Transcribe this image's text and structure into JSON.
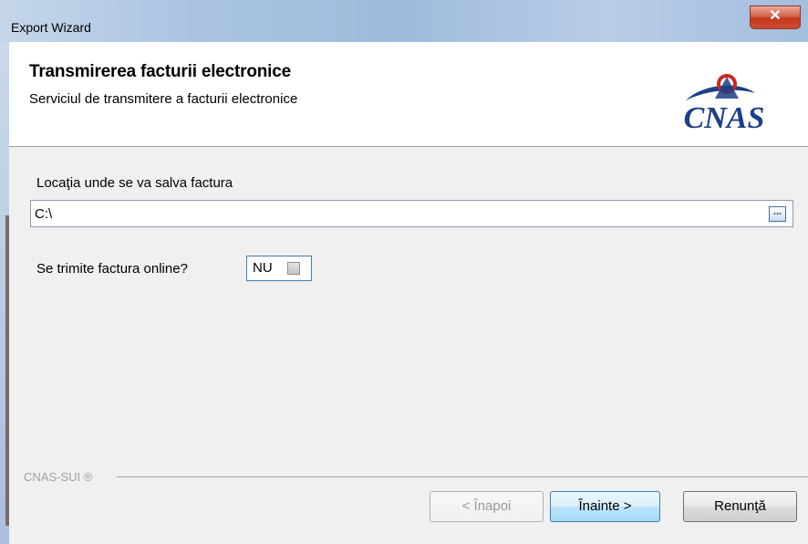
{
  "window": {
    "title": "Export Wizard",
    "close_glyph": "✕"
  },
  "header": {
    "title": "Transmirerea facturii electronice",
    "subtitle": "Serviciul de transmitere a facturii electronice",
    "logo_text": "CNAS",
    "logo_icon": "cnas-logo-icon"
  },
  "form": {
    "location_label": "Locaţia unde se va salva factura",
    "location_value": "C:\\",
    "browse_label": "...",
    "online_label": "Se trimite factura online?",
    "online_value": "NU",
    "online_checked": false
  },
  "footer": {
    "brand": "CNAS-SUI ®",
    "back_label": "< Înapoi",
    "next_label": "Înainte >",
    "cancel_label": "Renunţă"
  },
  "colors": {
    "titlebar": "#a9c3e0",
    "close_button": "#c2381f",
    "logo_red": "#c8281e",
    "logo_blue": "#1d3f86",
    "focus_border": "#3c7fb1"
  }
}
